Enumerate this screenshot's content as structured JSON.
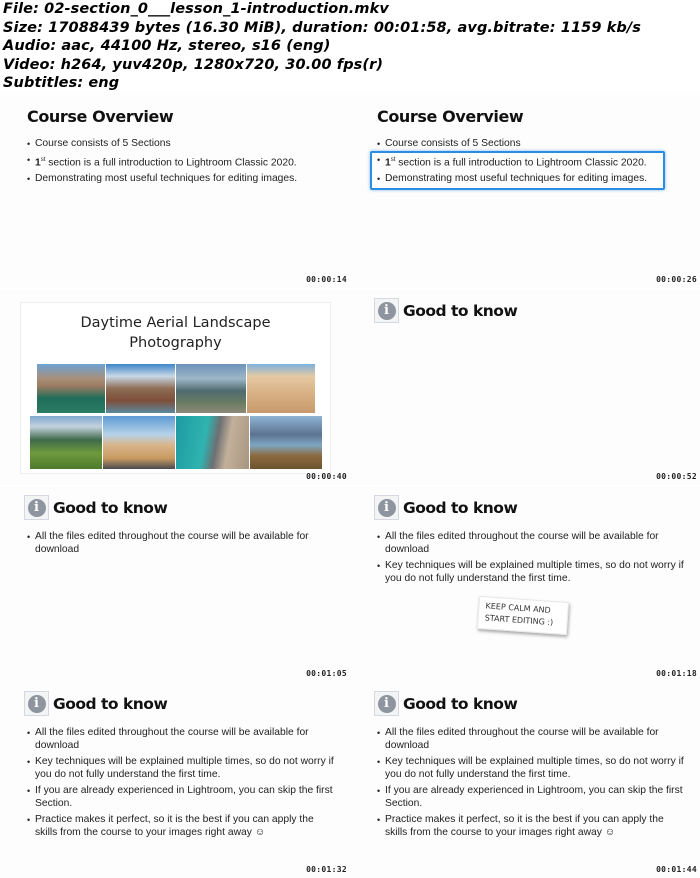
{
  "header": {
    "file_line": "File: 02-section_0___lesson_1-introduction.mkv",
    "size_line": "Size: 17088439 bytes (16.30 MiB), duration: 00:01:58, avg.bitrate: 1159 kb/s",
    "audio_line": "Audio: aac, 44100 Hz, stereo, s16 (eng)",
    "video_line": "Video: h264, yuv420p, 1280x720, 30.00 fps(r)",
    "subtitles_line": "Subtitles: eng"
  },
  "accent_color": "#2b8de0",
  "thumbnails": [
    {
      "timestamp": "00:00:14",
      "title": "Course Overview",
      "bullets": [
        {
          "sup_prefix": "",
          "text": "Course consists of 5 Sections"
        },
        {
          "bold": "1",
          "sup": "st",
          "text": " section is a full introduction to Lightroom Classic 2020."
        },
        {
          "text": "Demonstrating most useful techniques for editing images."
        }
      ]
    },
    {
      "timestamp": "00:00:26",
      "title": "Course Overview",
      "highlighted": true,
      "bullets": [
        {
          "text": "Course consists of 5 Sections"
        },
        {
          "bold": "1",
          "sup": "st",
          "text": " section is a full introduction to Lightroom Classic 2020."
        },
        {
          "text": "Demonstrating most useful techniques for editing images."
        }
      ]
    },
    {
      "timestamp": "00:00:40",
      "title_line1": "Daytime Aerial Landscape",
      "title_line2": "Photography",
      "photos": [
        "dam-reservoir",
        "mountain-road",
        "city-skyline",
        "desert-road-curve",
        "green-valley",
        "desert-highway",
        "coastal-road",
        "lake-causeway"
      ]
    },
    {
      "timestamp": "00:00:52",
      "title": "Good to know",
      "bullets": []
    },
    {
      "timestamp": "00:01:05",
      "title": "Good to know",
      "bullets": [
        "All the files edited throughout the course will be available for download"
      ]
    },
    {
      "timestamp": "00:01:18",
      "title": "Good to know",
      "bullets": [
        "All the files edited throughout the course will be available for download",
        "Key techniques will be explained multiple times, so do not worry if you do not fully understand the first time."
      ],
      "sticker_line1": "KEEP CALM AND",
      "sticker_line2": "START EDITING :)"
    },
    {
      "timestamp": "00:01:32",
      "title": "Good to know",
      "bullets": [
        "All the files edited throughout the course will be available for download",
        "Key techniques will be explained multiple times, so do not worry if you do not fully understand the first time.",
        "If you are already experienced in Lightroom, you can skip the first Section.",
        "Practice makes it perfect, so it is the best if you can apply the skills from the course to your images right away ☺"
      ]
    },
    {
      "timestamp": "00:01:44",
      "title": "Good to know",
      "bullets": [
        "All the files edited throughout the course will be available for download",
        "Key techniques will be explained multiple times, so do not worry if you do not fully understand the first time.",
        "If you are already experienced in Lightroom, you can skip the first Section.",
        "Practice makes it perfect, so it is the best if you can apply the skills from the course to your images right away ☺"
      ]
    }
  ]
}
